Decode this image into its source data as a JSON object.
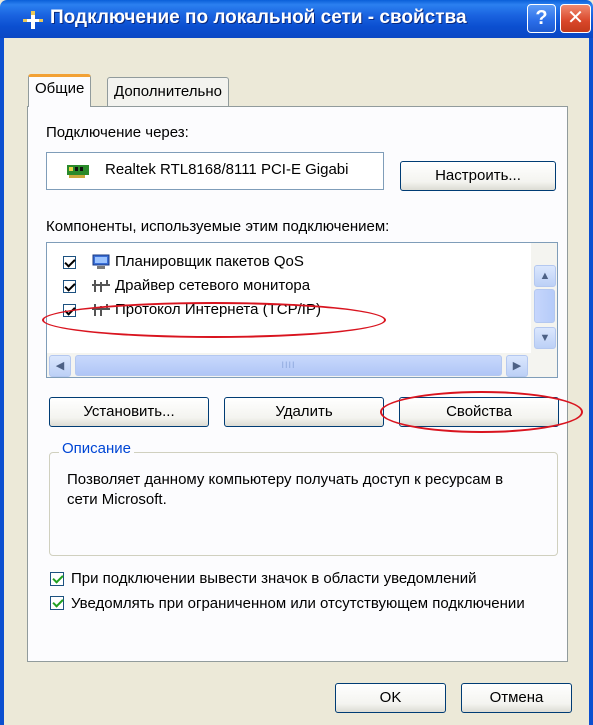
{
  "window": {
    "title": "Подключение по локальной сети - свойства",
    "help_glyph": "?",
    "close_glyph": "✕"
  },
  "tabs": [
    {
      "label": "Общие",
      "active": true
    },
    {
      "label": "Дополнительно",
      "active": false
    }
  ],
  "connection": {
    "label": "Подключение через:",
    "adapter": "Realtek RTL8168/8111 PCI-E Gigabi",
    "configure_button": "Настроить..."
  },
  "components": {
    "label": "Компоненты, используемые этим подключением:",
    "items": [
      {
        "label": "Планировщик пакетов QoS",
        "icon": "qos-scheduler-icon",
        "checked": true
      },
      {
        "label": "Драйвер сетевого монитора",
        "icon": "network-protocol-icon",
        "checked": true
      },
      {
        "label": "Протокол Интернета (TCP/IP)",
        "icon": "network-protocol-icon",
        "checked": true
      }
    ]
  },
  "buttons": {
    "install": "Установить...",
    "remove": "Удалить",
    "properties": "Свойства",
    "ok": "OK",
    "cancel": "Отмена"
  },
  "description": {
    "title": "Описание",
    "text": "Позволяет данному компьютеру получать доступ к ресурсам в сети Microsoft."
  },
  "options": [
    {
      "label": "При подключении вывести значок в области уведомлений",
      "checked": true
    },
    {
      "label": "Уведомлять при ограниченном или отсутствующем подключении",
      "checked": true
    }
  ],
  "colors": {
    "titlebar": "#0b4fd0",
    "annotation": "#d9141f",
    "group_title": "#0046d5"
  }
}
